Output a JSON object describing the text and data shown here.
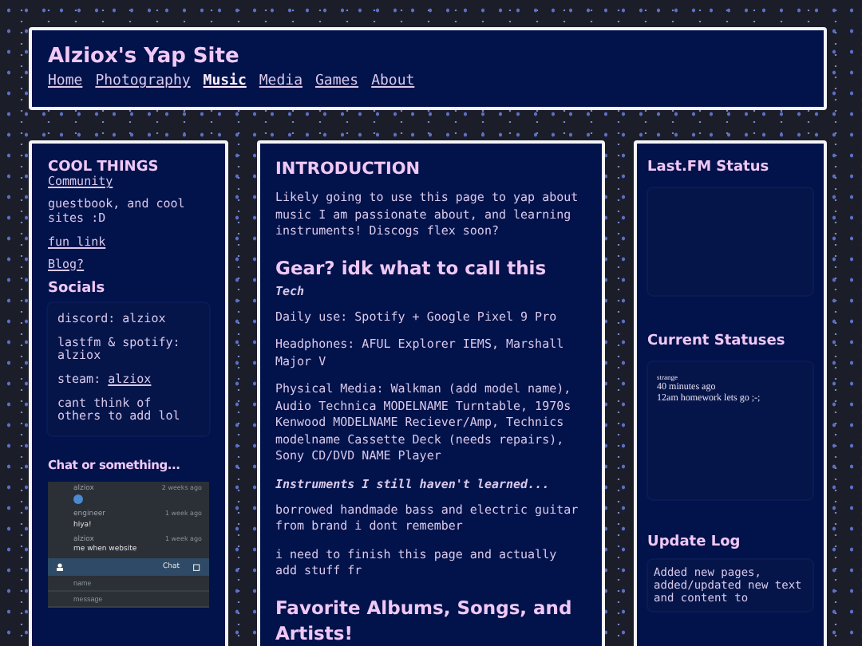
{
  "header": {
    "title": "Alziox's Yap Site",
    "nav": [
      {
        "label": "Home",
        "selected": false
      },
      {
        "label": "Photography",
        "selected": false
      },
      {
        "label": "Music",
        "selected": true
      },
      {
        "label": "Media",
        "selected": false
      },
      {
        "label": "Games",
        "selected": false
      },
      {
        "label": "About",
        "selected": false
      }
    ]
  },
  "left": {
    "title": "COOL THINGS",
    "items": [
      {
        "kind": "link",
        "text": "Community"
      },
      {
        "kind": "text",
        "text": "guestbook, and cool sites :D"
      },
      {
        "kind": "link",
        "text": "fun link"
      },
      {
        "kind": "link",
        "text": "Blog?"
      }
    ],
    "socials": {
      "title": "Socials",
      "items": [
        {
          "kind": "text",
          "text": "discord: alziox"
        },
        {
          "kind": "text",
          "text": "lastfm & spotify: alziox"
        },
        {
          "kind": "link",
          "prefix": "steam:",
          "text": "alziox"
        },
        {
          "kind": "text",
          "text": "cant think of others to add lol"
        }
      ]
    },
    "chat": {
      "title": "Chat or something...",
      "messages": [
        {
          "user": "alziox",
          "time": "2 weeks ago"
        },
        {
          "user": "engineer",
          "time": "1 week ago",
          "text": "hiya!"
        },
        {
          "user": "alziox",
          "time": "1 week ago",
          "text": "me when website"
        }
      ],
      "bar_label": "Chat",
      "fields": [
        {
          "placeholder": "name"
        },
        {
          "placeholder": "message"
        }
      ]
    }
  },
  "main": [
    {
      "kind": "h1",
      "text": "INTRODUCTION"
    },
    {
      "kind": "para",
      "text": "Likely going to use this page to yap about music I am passionate about, and learning instruments! Discogs flex soon?"
    },
    {
      "kind": "h2",
      "text": "Gear? idk what to call this"
    },
    {
      "kind": "sub",
      "text": "Tech"
    },
    {
      "kind": "para",
      "text": "Daily use: Spotify + Google Pixel 9 Pro"
    },
    {
      "kind": "para",
      "text": "Headphones: AFUL Explorer IEMS, Marshall Major V"
    },
    {
      "kind": "para",
      "text": "Physical Media: Walkman (add model name), Audio Technica MODELNAME Turntable, 1970s Kenwood MODELNAME Reciever/Amp, Technics modelname Cassette Deck (needs repairs), Sony CD/DVD NAME Player"
    },
    {
      "kind": "sub",
      "text": "Instruments I still haven't learned..."
    },
    {
      "kind": "para",
      "text": "borrowed handmade bass and electric guitar from brand i dont remember"
    },
    {
      "kind": "para",
      "text": "i need to finish this page and actually add stuff fr"
    },
    {
      "kind": "h2",
      "text": "Favorite Albums, Songs, and Artists!"
    }
  ],
  "right": {
    "lastfm_title": "Last.FM Status",
    "statuses_title": "Current Statuses",
    "status": {
      "user": "strange",
      "time": "40 minutes ago",
      "text": "12am homework lets go ;-;"
    },
    "log_title": "Update Log",
    "log_text": "Added new pages, added/updated new text and content to"
  }
}
